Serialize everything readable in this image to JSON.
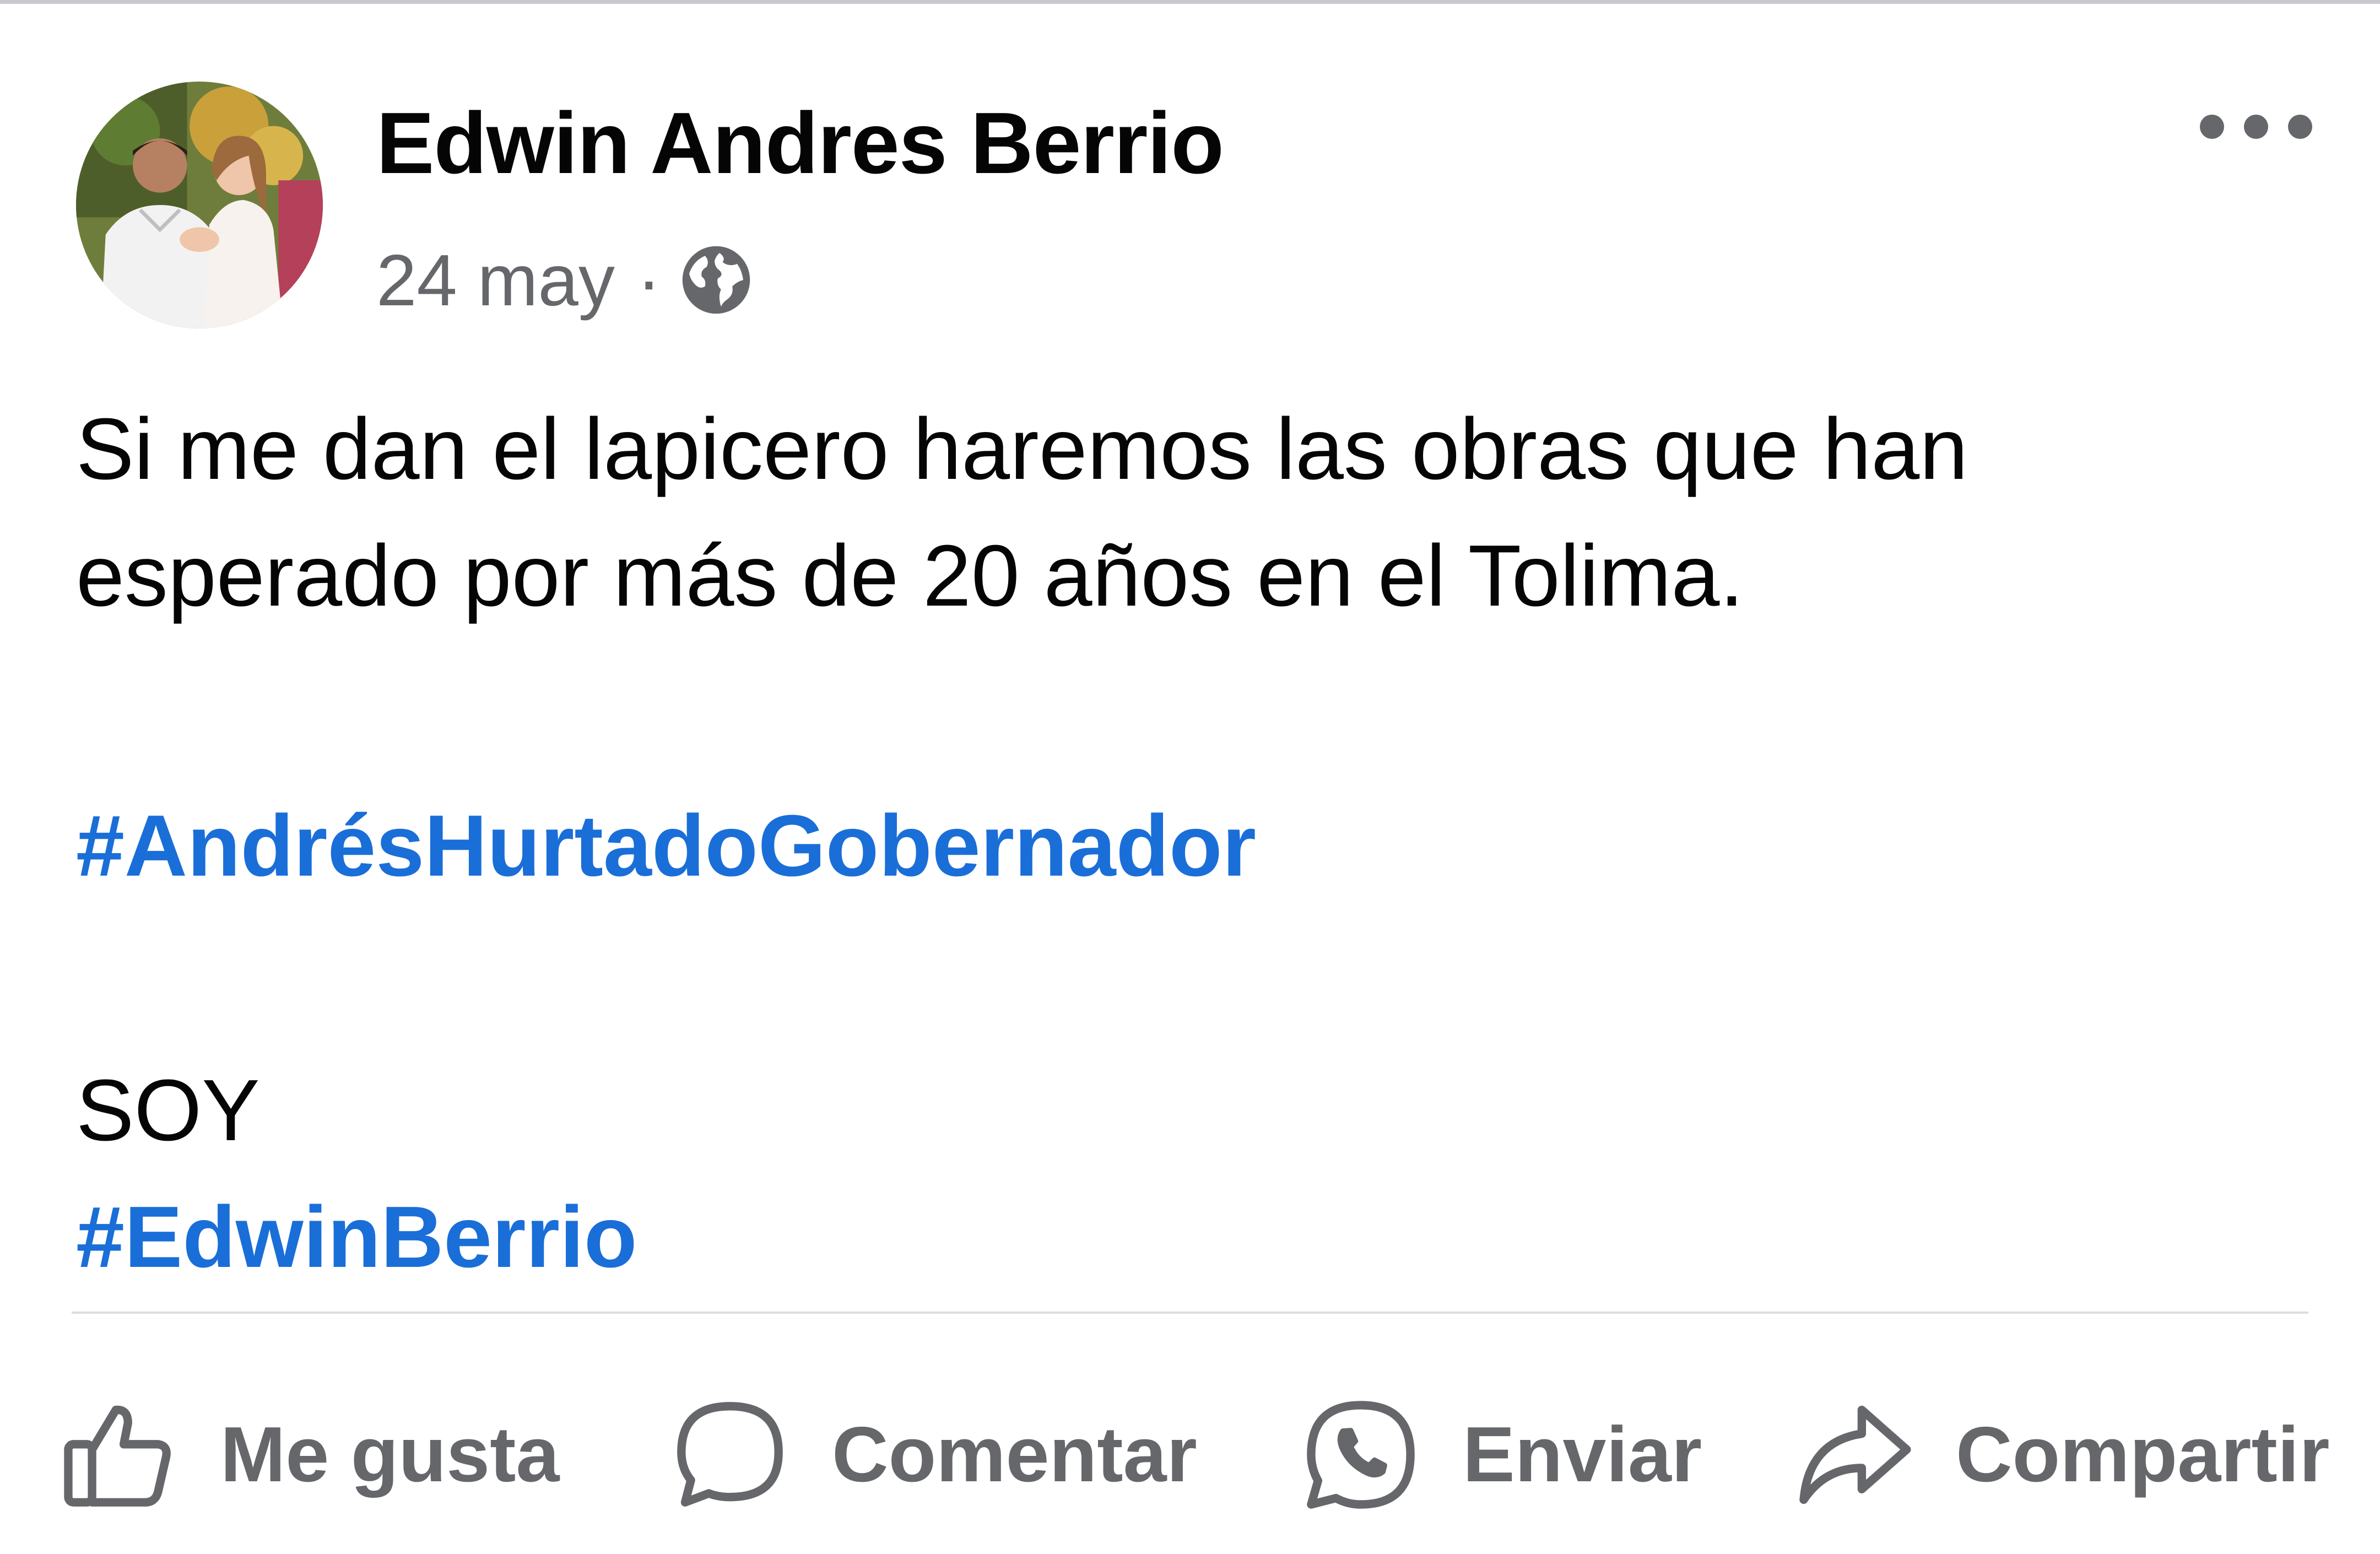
{
  "post": {
    "author_name": "Edwin Andres Berrio",
    "date": "24 may",
    "separator": "·",
    "privacy_icon": "globe-icon",
    "more_icon": "more-horizontal-icon",
    "text_lines": [
      "Si me dan el lapicero haremos las obras que han",
      "esperado por más de 20 años en el Tolima."
    ],
    "hashtag_primary": "#AndrésHurtadoGobernador",
    "soy_label": "SOY",
    "hashtag_secondary": "#EdwinBerrio"
  },
  "actions": {
    "like_label": "Me gusta",
    "comment_label": "Comentar",
    "send_label": "Enviar",
    "share_label": "Compartir"
  },
  "colors": {
    "hashtag": "#1a6ed8",
    "secondary_text": "#65676b",
    "primary_text": "#050505",
    "divider": "#dadde1"
  }
}
